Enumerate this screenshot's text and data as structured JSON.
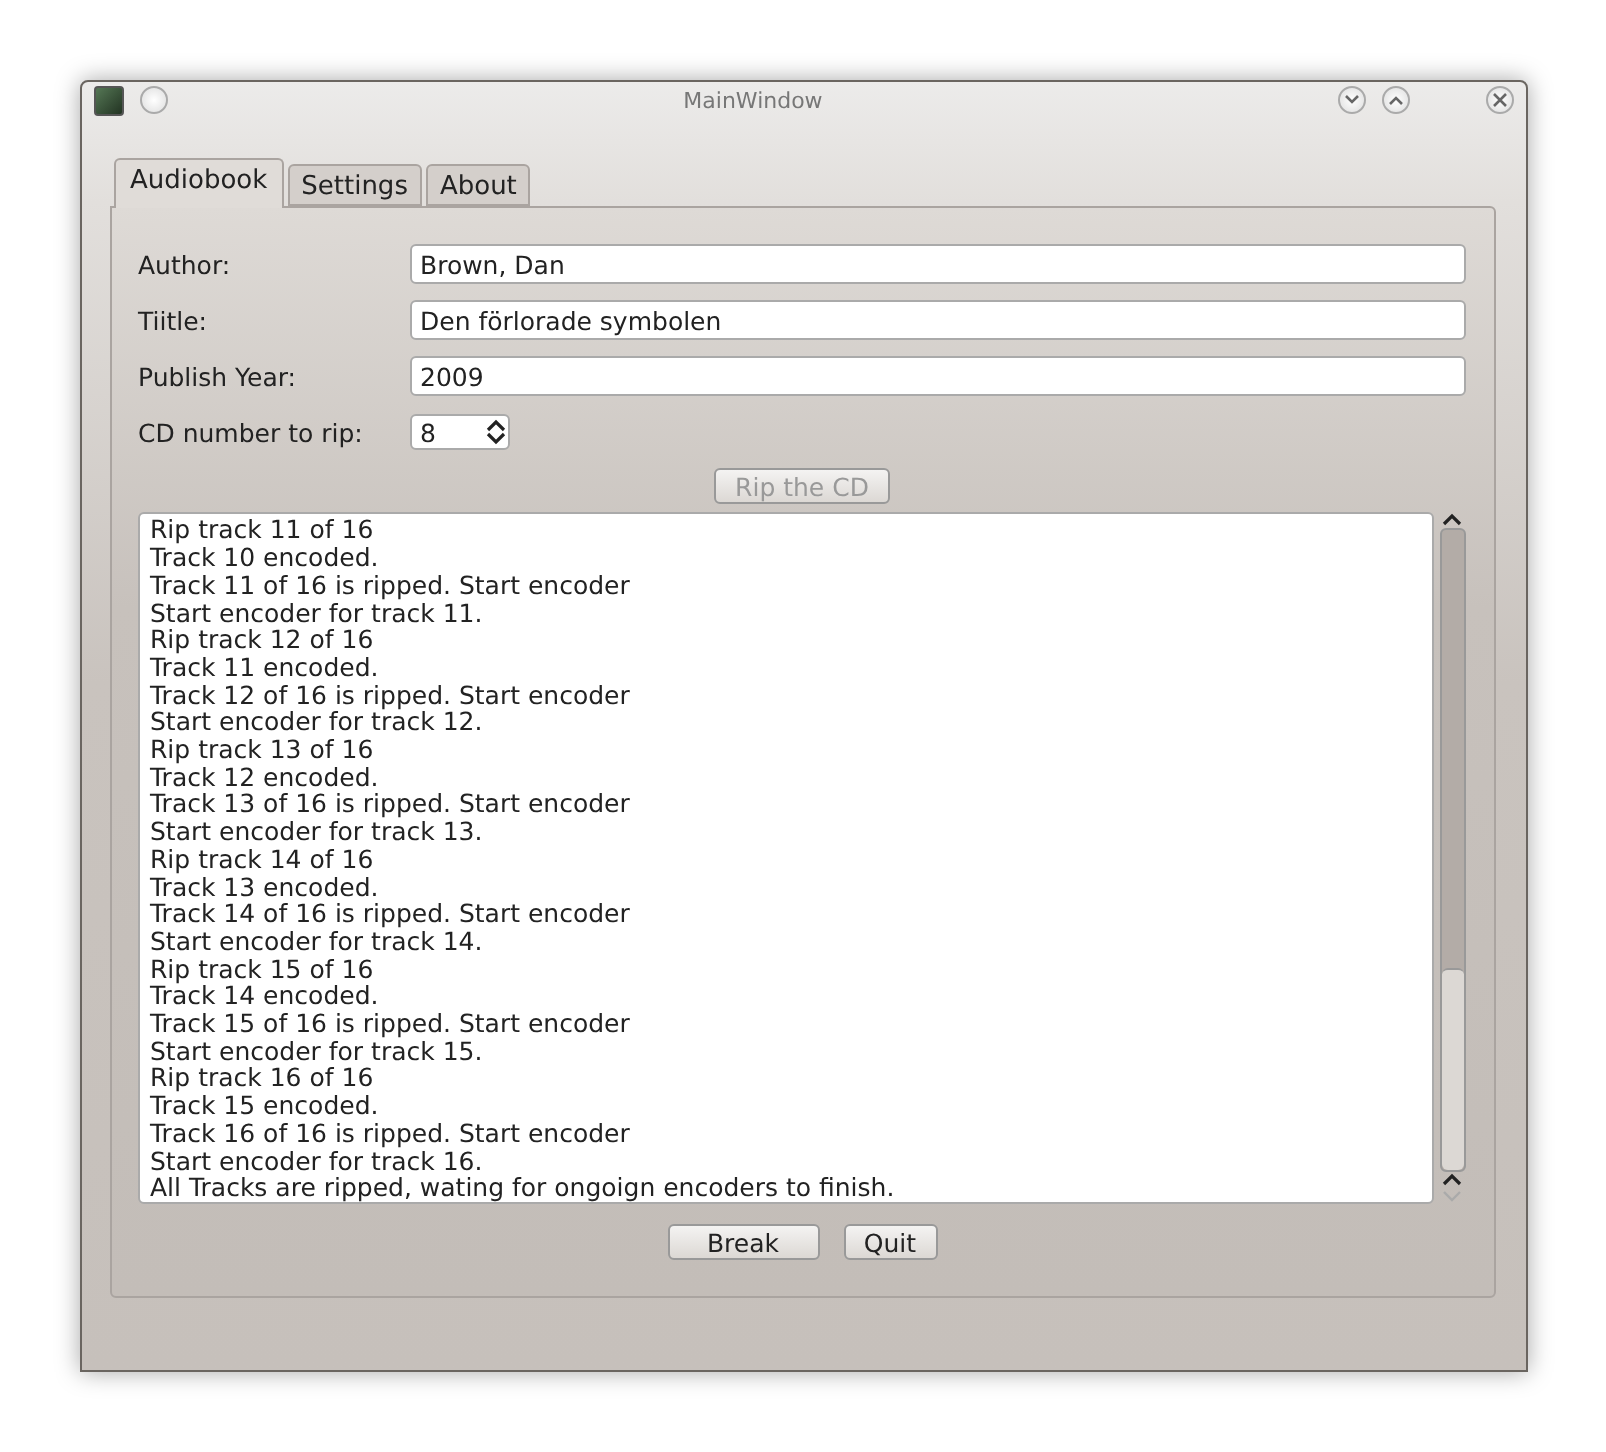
{
  "window": {
    "title": "MainWindow"
  },
  "tabs": [
    {
      "label": "Audiobook",
      "selected": true
    },
    {
      "label": "Settings",
      "selected": false
    },
    {
      "label": "About",
      "selected": false
    }
  ],
  "form": [
    {
      "label": "Author:",
      "value": "Brown, Dan",
      "kind": "text"
    },
    {
      "label": "Tiitle:",
      "value": "Den förlorade symbolen",
      "kind": "text"
    },
    {
      "label": "Publish Year:",
      "value": "2009",
      "kind": "text"
    },
    {
      "label": "CD number to rip:",
      "value": "8",
      "kind": "spin"
    }
  ],
  "rip_button": {
    "label": "Rip the CD",
    "disabled": true
  },
  "log": [
    "Rip track 11 of 16",
    "Track 10 encoded.",
    "Track 11 of 16 is ripped. Start encoder",
    "Start encoder for track 11.",
    "Rip track 12 of 16",
    "Track 11 encoded.",
    "Track 12 of 16 is ripped. Start encoder",
    "Start encoder for track 12.",
    "Rip track 13 of 16",
    "Track 12 encoded.",
    "Track 13 of 16 is ripped. Start encoder",
    "Start encoder for track 13.",
    "Rip track 14 of 16",
    "Track 13 encoded.",
    "Track 14 of 16 is ripped. Start encoder",
    "Start encoder for track 14.",
    "Rip track 15 of 16",
    "Track 14 encoded.",
    "Track 15 of 16 is ripped. Start encoder",
    "Start encoder for track 15.",
    "Rip track 16 of 16",
    "Track 15 encoded.",
    "Track 16 of 16 is ripped. Start encoder",
    "Start encoder for track 16.",
    "All Tracks are ripped, wating for ongoign encoders to finish."
  ],
  "buttons": [
    {
      "label": "Break",
      "kind": "wide"
    },
    {
      "label": "Quit",
      "kind": "narrow"
    }
  ]
}
